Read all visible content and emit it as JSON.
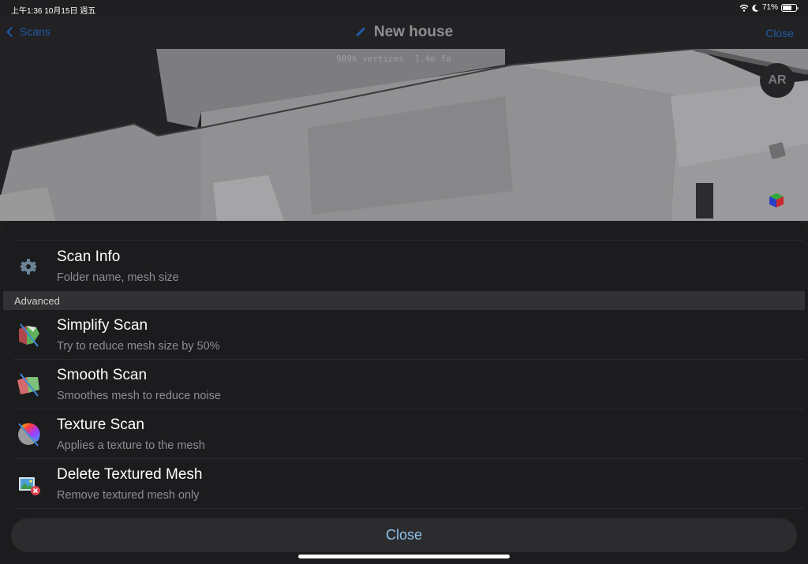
{
  "status_bar": {
    "time_date": "上午1:36   10月15日 週五",
    "battery_percent_label": "71%",
    "battery_level": 0.71,
    "icons": [
      "wifi-icon",
      "moon-icon",
      "battery-icon"
    ]
  },
  "navbar": {
    "back_label": "Scans",
    "title": "New house",
    "close_label": "Close"
  },
  "viewport": {
    "stats_overlay": "909k vertices  1.4m fa",
    "ar_label": "AR"
  },
  "sheet": {
    "scan_info": {
      "title": "Scan Info",
      "subtitle": "Folder name, mesh size",
      "icon": "gear-icon"
    },
    "section_header": "Advanced",
    "items": [
      {
        "title": "Simplify Scan",
        "subtitle": "Try to reduce mesh size by 50%",
        "icon": "simplify-mesh-icon"
      },
      {
        "title": "Smooth Scan",
        "subtitle": "Smoothes mesh to reduce noise",
        "icon": "smooth-mesh-icon"
      },
      {
        "title": "Texture Scan",
        "subtitle": "Applies a texture to the mesh",
        "icon": "texture-sphere-icon"
      },
      {
        "title": "Delete Textured Mesh",
        "subtitle": "Remove textured mesh only",
        "icon": "delete-texture-icon"
      }
    ],
    "close_label": "Close"
  },
  "colors": {
    "accent_blue": "#1f5aa6",
    "close_button_text": "#8fc4ee",
    "sheet_bg": "#1c1c1e",
    "section_bg": "#323234",
    "delete_badge": "#e0404f"
  }
}
